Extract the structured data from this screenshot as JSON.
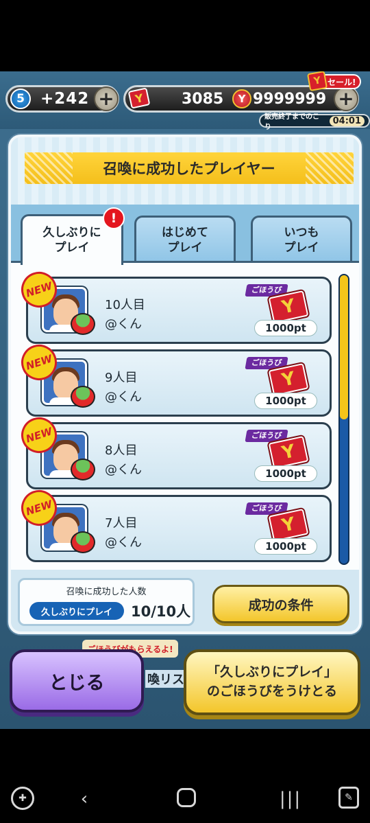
{
  "topbar": {
    "level": "5",
    "stamina": "+242",
    "points": "3085",
    "coins": "9999999",
    "sale_label": "セール!",
    "sale_timer_label": "販売終了までのこり",
    "sale_timer": "04:01",
    "ticket_glyph": "Y",
    "coin_glyph": "Y"
  },
  "dialog": {
    "title": "召喚に成功したプレイヤー",
    "tabs": [
      {
        "line1": "久しぶりに",
        "line2": "プレイ",
        "active": true
      },
      {
        "line1": "はじめて",
        "line2": "プレイ",
        "active": false
      },
      {
        "line1": "いつも",
        "line2": "プレイ",
        "active": false
      }
    ],
    "alert_mark": "!",
    "rows": [
      {
        "badge": "NEW",
        "order": "10人目",
        "name": "@くん",
        "reward_label": "ごほうび",
        "reward_glyph": "Y",
        "reward_points": "1000pt"
      },
      {
        "badge": "NEW",
        "order": "9人目",
        "name": "@くん",
        "reward_label": "ごほうび",
        "reward_glyph": "Y",
        "reward_points": "1000pt"
      },
      {
        "badge": "NEW",
        "order": "8人目",
        "name": "@くん",
        "reward_label": "ごほうび",
        "reward_glyph": "Y",
        "reward_points": "1000pt"
      },
      {
        "badge": "NEW",
        "order": "7人目",
        "name": "@くん",
        "reward_label": "ごほうび",
        "reward_glyph": "Y",
        "reward_points": "1000pt"
      }
    ],
    "count_title": "召喚に成功した人数",
    "count_tag": "久しぶりにプレイ",
    "count_value": "10/10人",
    "conditions_button": "成功の条件"
  },
  "background": {
    "peek_banner": "ごほうびがもらえるよ!",
    "peek_text": "喚リス"
  },
  "buttons": {
    "close": "とじる",
    "claim_line1": "「久しぶりにプレイ」",
    "claim_line2": "のごほうびをうけとる"
  },
  "colors": {
    "title_banner": "#f4bf1b",
    "close_button": "#9a6be6",
    "claim_button": "#f3c62b",
    "scroll_thumb": "#f5c51a",
    "alert": "#e4161f"
  },
  "icons": {
    "nav_back": "‹",
    "nav_recent": "|||",
    "nav_game": "✚",
    "nav_tool": "✎",
    "plus": "+"
  }
}
